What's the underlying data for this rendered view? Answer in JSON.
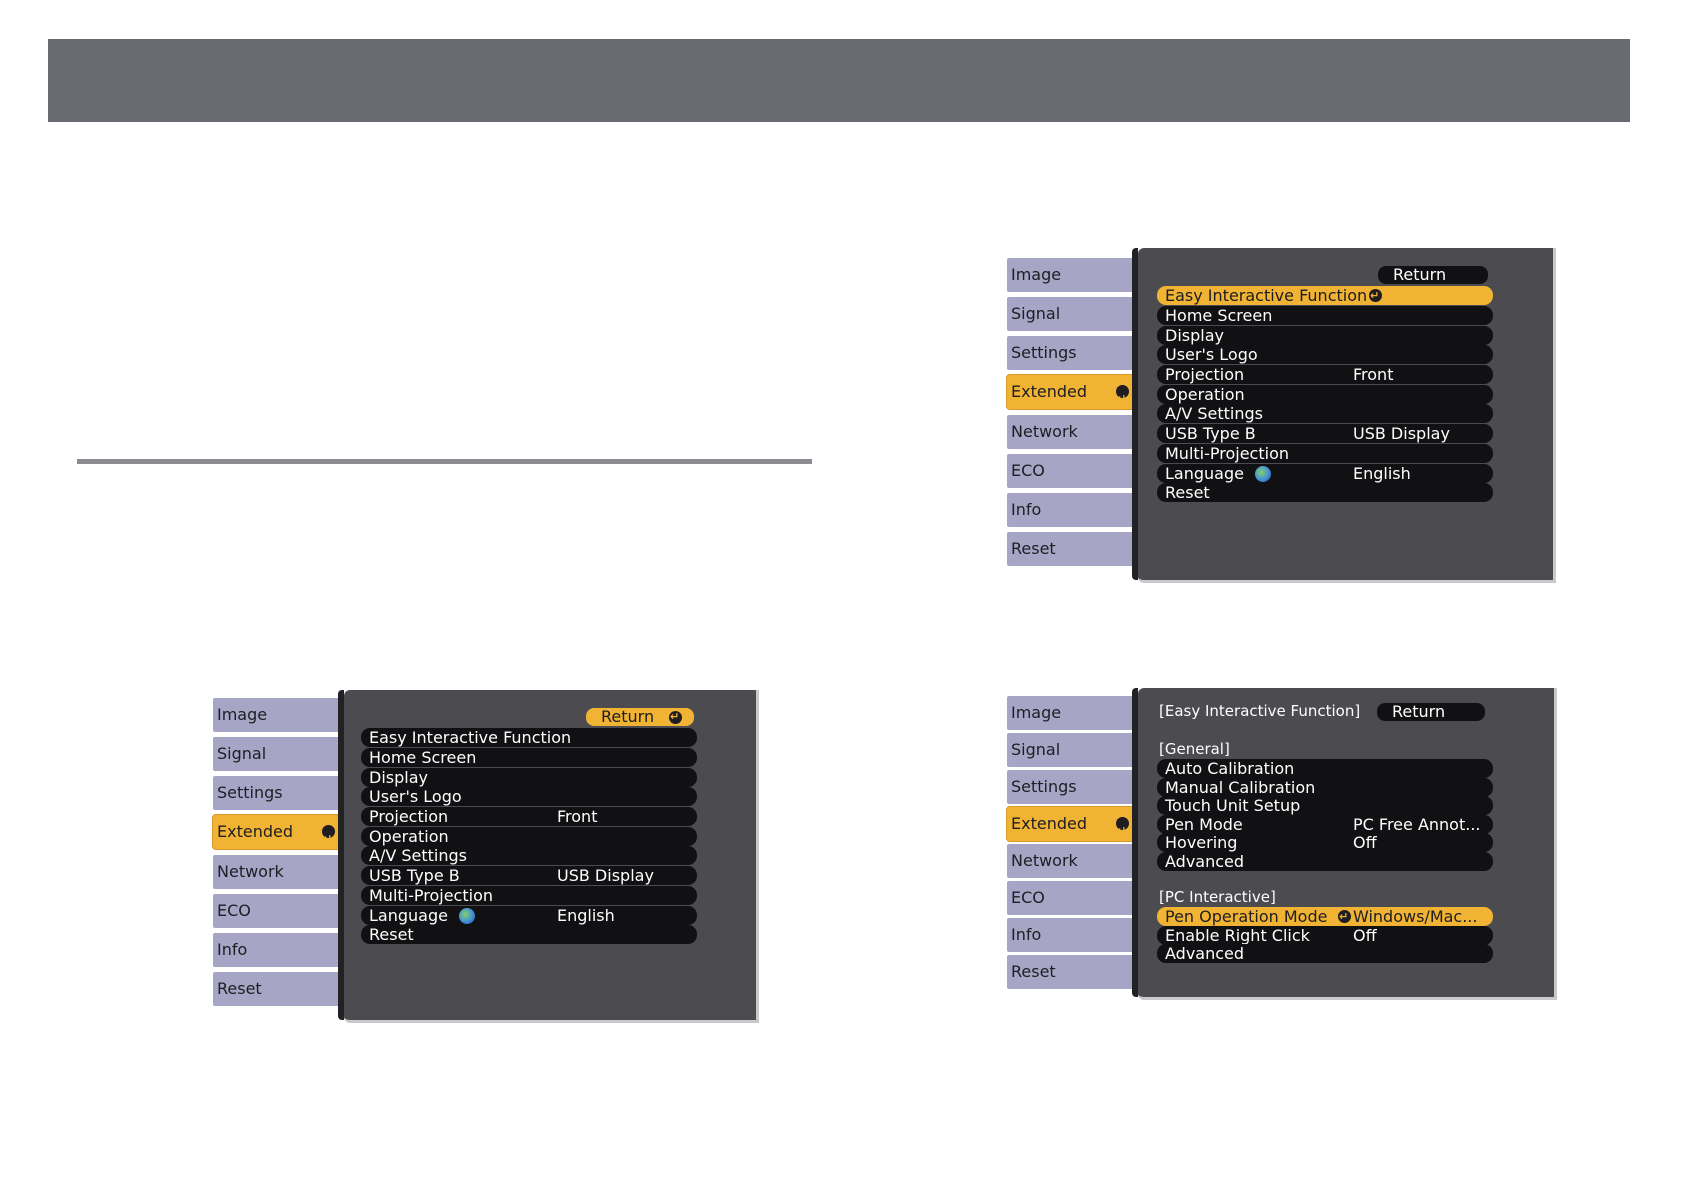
{
  "tabs": [
    "Image",
    "Signal",
    "Settings",
    "Extended",
    "Network",
    "ECO",
    "Info",
    "Reset"
  ],
  "extended_menu": {
    "return_label": "Return",
    "items": [
      {
        "label": "Easy Interactive Function",
        "value": ""
      },
      {
        "label": "Home Screen",
        "value": ""
      },
      {
        "label": "Display",
        "value": ""
      },
      {
        "label": "User's Logo",
        "value": ""
      },
      {
        "label": "Projection",
        "value": "Front"
      },
      {
        "label": "Operation",
        "value": ""
      },
      {
        "label": "A/V Settings",
        "value": ""
      },
      {
        "label": "USB Type B",
        "value": "USB Display"
      },
      {
        "label": "Multi-Projection",
        "value": ""
      },
      {
        "label": "Language",
        "value": "English"
      },
      {
        "label": "Reset",
        "value": ""
      }
    ]
  },
  "eif_menu": {
    "title": "[Easy Interactive Function]",
    "return_label": "Return",
    "general_title": "[General]",
    "general_items": [
      {
        "label": "Auto Calibration",
        "value": ""
      },
      {
        "label": "Manual Calibration",
        "value": ""
      },
      {
        "label": "Touch Unit Setup",
        "value": ""
      },
      {
        "label": "Pen Mode",
        "value": "PC Free Annot..."
      },
      {
        "label": "Hovering",
        "value": "Off"
      },
      {
        "label": "Advanced",
        "value": ""
      }
    ],
    "pc_title": "[PC Interactive]",
    "pc_items": [
      {
        "label": "Pen Operation Mode",
        "value": "Windows/Mac..."
      },
      {
        "label": "Enable Right Click",
        "value": "Off"
      },
      {
        "label": "Advanced",
        "value": ""
      }
    ]
  }
}
